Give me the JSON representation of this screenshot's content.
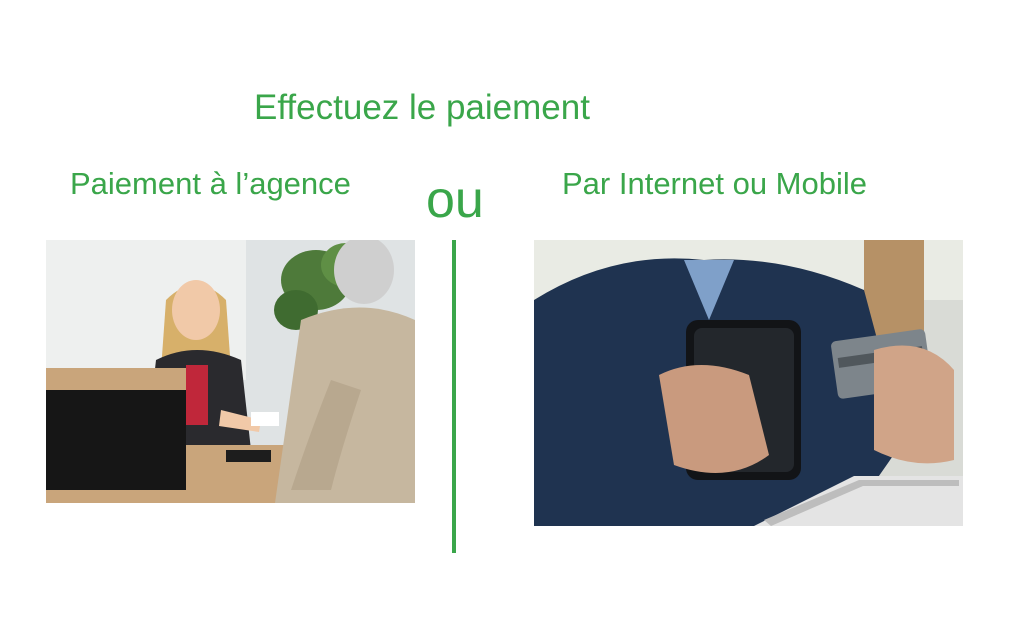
{
  "title": "Effectuez le paiement",
  "options": {
    "left_label": "Paiement à l’agence",
    "separator": "ou",
    "right_label": "Par Internet ou Mobile"
  },
  "colors": {
    "accent": "#3aa64a"
  }
}
